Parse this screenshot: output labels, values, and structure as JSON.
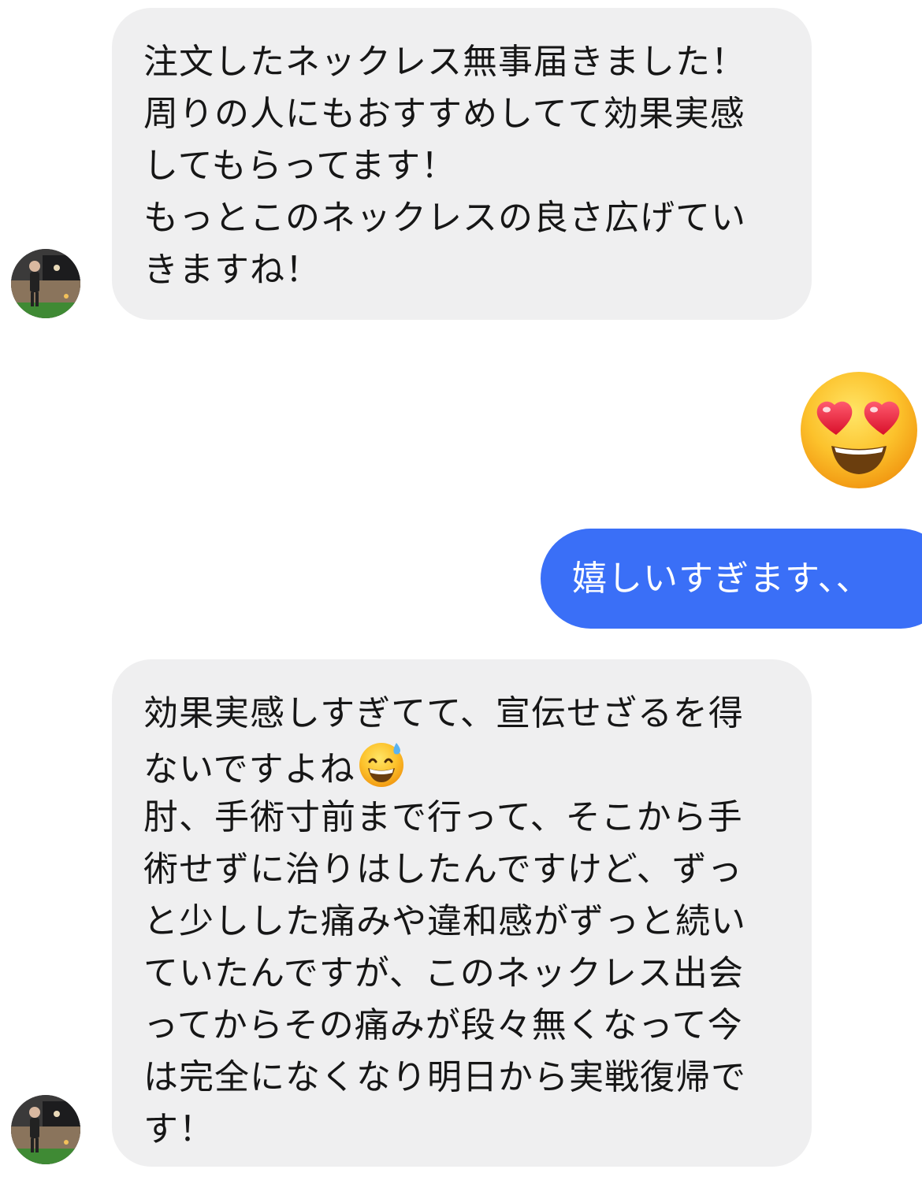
{
  "thread": {
    "incoming_1": {
      "lines": [
        "注文したネックレス無事届きました！",
        "周りの人にもおすすめしてて効果実感",
        "してもらってます！",
        "もっとこのネックレスの良さ広げてい",
        "きますね！"
      ]
    },
    "reaction": {
      "icon": "heart-eyes-emoji"
    },
    "outgoing_1": {
      "text": "嬉しいすぎます、、"
    },
    "incoming_2": {
      "lines": [
        "効果実感しすぎてて、宣伝せざるを得",
        "ないですよね",
        "肘、手術寸前まで行って、そこから手",
        "術せずに治りはしたんですけど、ずっ",
        "と少しした痛みや違和感がずっと続い",
        "ていたんですが、このネックレス出会",
        "ってからその痛みが段々無くなって今",
        "は完全になくなり明日から実戦復帰で",
        "す！"
      ],
      "inline_icon": "grinning-sweat-emoji"
    }
  },
  "colors": {
    "incoming_bubble": "#efeff0",
    "outgoing_bubble": "#3a6ff7",
    "text_dark": "#161616",
    "text_light": "#ffffff"
  }
}
